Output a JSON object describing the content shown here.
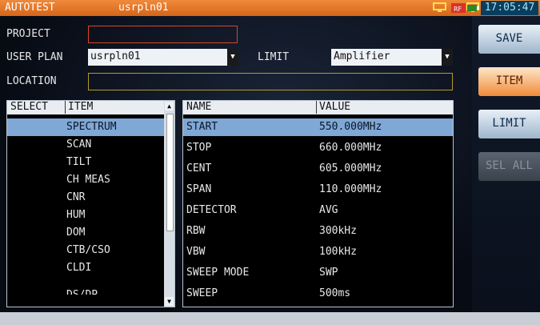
{
  "titlebar": {
    "app": "AUTOTEST",
    "file": "usrpln01",
    "time": "17:05:47"
  },
  "status_icons": [
    "network-icon",
    "rf-icon",
    "battery-plug-icon"
  ],
  "form": {
    "project_label": "PROJECT",
    "project_value": "",
    "user_plan_label": "USER PLAN",
    "user_plan_value": "usrpln01",
    "limit_label": "LIMIT",
    "limit_value": "Amplifier",
    "location_label": "LOCATION",
    "location_value": ""
  },
  "left_table": {
    "headers": [
      "SELECT",
      "ITEM"
    ],
    "items": [
      "SPECTRUM",
      "SCAN",
      "TILT",
      "CH MEAS",
      "CNR",
      "HUM",
      "DOM",
      "CTB/CSO",
      "CLDI",
      "DS/DP"
    ],
    "selected": "SPECTRUM"
  },
  "right_table": {
    "headers": [
      "NAME",
      "VALUE"
    ],
    "rows": [
      {
        "name": "START",
        "value": "550.000MHz"
      },
      {
        "name": "STOP",
        "value": "660.000MHz"
      },
      {
        "name": "CENT",
        "value": "605.000MHz"
      },
      {
        "name": "SPAN",
        "value": "110.000MHz"
      },
      {
        "name": "DETECTOR",
        "value": "AVG"
      },
      {
        "name": "RBW",
        "value": "300kHz"
      },
      {
        "name": "VBW",
        "value": "100kHz"
      },
      {
        "name": "SWEEP MODE",
        "value": "SWP"
      },
      {
        "name": "SWEEP",
        "value": "500ms"
      }
    ],
    "selected": "START"
  },
  "buttons": {
    "save": "SAVE",
    "item": "ITEM",
    "limit": "LIMIT",
    "sel_all": "SEL ALL"
  },
  "colors": {
    "accent": "#e8742a",
    "selection": "#7fa8d6",
    "clock": "#0b3d5c"
  }
}
